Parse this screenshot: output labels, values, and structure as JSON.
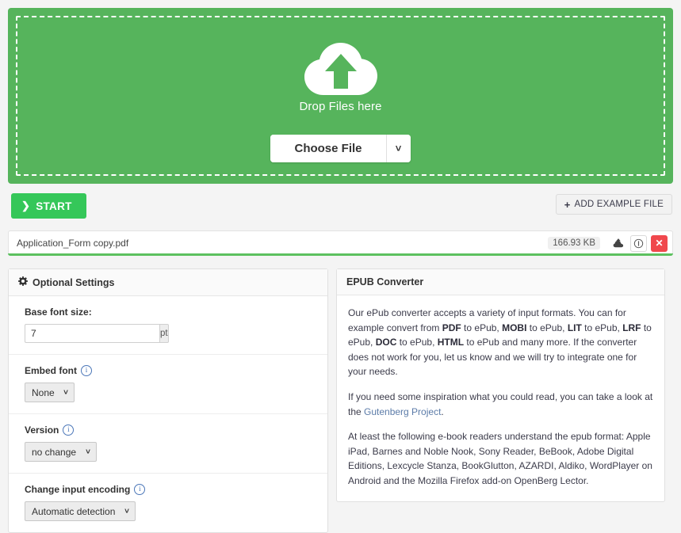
{
  "dropzone": {
    "icon": "cloud-upload-icon",
    "drop_label": "Drop Files here",
    "choose_file_label": "Choose File",
    "caret_icon": "chevron-down-icon",
    "bg_color": "#56b45c"
  },
  "actions": {
    "start_label": "START",
    "start_icon": "chevron-right-icon",
    "start_color": "#35c759",
    "example_label": "ADD EXAMPLE FILE",
    "example_icon": "plus-icon"
  },
  "file_row": {
    "name": "Application_Form copy.pdf",
    "size": "166.93 KB",
    "upload_icon": "cloud-upload-icon",
    "info_icon": "info-circle-icon",
    "close_icon": "close-icon",
    "close_color": "#f0484d",
    "progress_color": "#5cc15f",
    "progress_percent": 100
  },
  "settings_panel": {
    "icon": "gear-icon",
    "title": "Optional Settings",
    "items": [
      {
        "label": "Base font size:",
        "type": "number",
        "value": "7",
        "unit": "pt",
        "has_info": false
      },
      {
        "label": "Embed font",
        "type": "select",
        "value": "None",
        "options": [
          "None"
        ],
        "has_info": true,
        "info_icon": "info-circle-icon"
      },
      {
        "label": "Version",
        "type": "select",
        "value": "no change",
        "options": [
          "no change"
        ],
        "has_info": true,
        "info_icon": "info-circle-icon"
      },
      {
        "label": "Change input encoding",
        "type": "select",
        "value": "Automatic detection",
        "options": [
          "Automatic detection"
        ],
        "has_info": true,
        "info_icon": "info-circle-icon"
      }
    ]
  },
  "info_panel": {
    "title": "EPUB Converter",
    "paragraph1_parts": [
      {
        "text": "Our ePub converter accepts a variety of input formats. You can for example convert from ",
        "bold": false
      },
      {
        "text": "PDF",
        "bold": true
      },
      {
        "text": " to ePub, ",
        "bold": false
      },
      {
        "text": "MOBI",
        "bold": true
      },
      {
        "text": " to ePub, ",
        "bold": false
      },
      {
        "text": "LIT",
        "bold": true
      },
      {
        "text": " to ePub, ",
        "bold": false
      },
      {
        "text": "LRF",
        "bold": true
      },
      {
        "text": " to ePub, ",
        "bold": false
      },
      {
        "text": "DOC",
        "bold": true
      },
      {
        "text": " to ePub, ",
        "bold": false
      },
      {
        "text": "HTML",
        "bold": true
      },
      {
        "text": " to ePub and many more. If the converter does not work for you, let us know and we will try to integrate one for your needs.",
        "bold": false
      }
    ],
    "paragraph2_parts": [
      {
        "text": "If you need some inspiration what you could read, you can take a look at the ",
        "bold": false
      },
      {
        "text": "Gutenberg Project",
        "bold": false,
        "link": true
      },
      {
        "text": ".",
        "bold": false
      }
    ],
    "paragraph3_parts": [
      {
        "text": "At least the following e-book readers understand the epub format: Apple iPad, Barnes and Noble Nook, Sony Reader, BeBook, Adobe Digital Editions, Lexcycle Stanza, BookGlutton, AZARDI, Aldiko, WordPlayer on Android and the Mozilla Firefox add-on OpenBerg Lector.",
        "bold": false
      }
    ],
    "link_color": "#5b7ba8"
  }
}
